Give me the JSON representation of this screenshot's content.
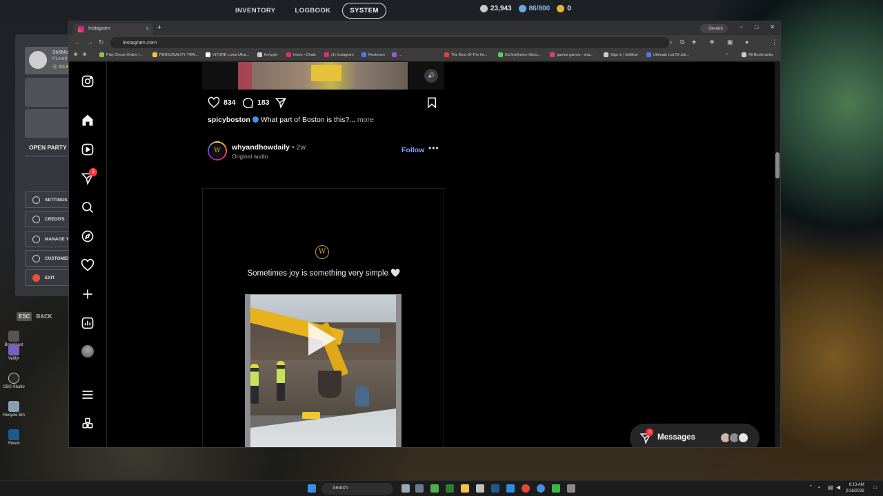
{
  "game_overlay": {
    "nav": [
      "INVENTORY",
      "LOGBOOK",
      "SYSTEM"
    ],
    "active_nav": "SYSTEM",
    "currencies": [
      {
        "value": "23,943",
        "color": "#c9c9c9"
      },
      {
        "value": "86/800",
        "color": "#6fa8dc"
      },
      {
        "value": "0",
        "color": "#e3b23c"
      }
    ],
    "profile": {
      "name": "Str8Me",
      "sub": "PLworl",
      "status": "⦿ IDLE"
    },
    "open_party": "OPEN PARTY",
    "menu": [
      "SETTINGS",
      "CREDITS",
      "MANAGE Y",
      "CUSTOMER",
      "EXIT"
    ],
    "back_key": "ESC",
    "back_label": "BACK"
  },
  "desktop_icons": [
    "Broadcast",
    "Veilfyr",
    "OBS Studio",
    "Recycle Bin",
    "Steam"
  ],
  "browser": {
    "tab_title": "Instagram",
    "tab_close": "×",
    "new_tab": "+",
    "gemini": "Gemini",
    "url": "instagram.com",
    "bookmarks": [
      {
        "label": "Play Chess Online f...",
        "color": "#8cc04a"
      },
      {
        "label": "PERSONALITY TRAI...",
        "color": "#f0c040"
      },
      {
        "label": "VITURE Luma Ultra...",
        "color": "#ffffff"
      },
      {
        "label": "femygirl",
        "color": "#cccccc"
      },
      {
        "label": "Inbox • Chats",
        "color": "#e1306c"
      },
      {
        "label": "(1) Instagram",
        "color": "#e1306c"
      },
      {
        "label": "Restream",
        "color": "#4a7cf0"
      },
      {
        "label": "...",
        "color": "#9b59d0"
      },
      {
        "label": "The Best Of The Int...",
        "color": "#e04040"
      },
      {
        "label": "DeJenQueen Strea...",
        "color": "#53d25a"
      },
      {
        "label": "games games - sha...",
        "color": "#e04070"
      },
      {
        "label": "Sign in | JetBlue",
        "color": "#cccccc"
      },
      {
        "label": "Ultimate List Of Jok...",
        "color": "#4a7cf0"
      },
      {
        "label": "All Bookmarks",
        "color": "#cccccc"
      }
    ]
  },
  "instagram": {
    "notifications_badge": "3",
    "prev_post": {
      "likes": "834",
      "comments": "183",
      "caption_user": "spicyboston",
      "caption_text": "What part of Boston is this?...",
      "more": "more"
    },
    "post": {
      "username": "whyandhowdaily",
      "time": "• 2w",
      "audio": "Original audio",
      "follow": "Follow",
      "options": "•••",
      "logo_letter": "W",
      "reel_text": "Sometimes joy is something very simple 🤍"
    },
    "messages": {
      "label": "Messages",
      "badge": "3"
    }
  },
  "taskbar": {
    "search": "Search",
    "time": "6:13 AM",
    "date": "2/16/2026"
  }
}
